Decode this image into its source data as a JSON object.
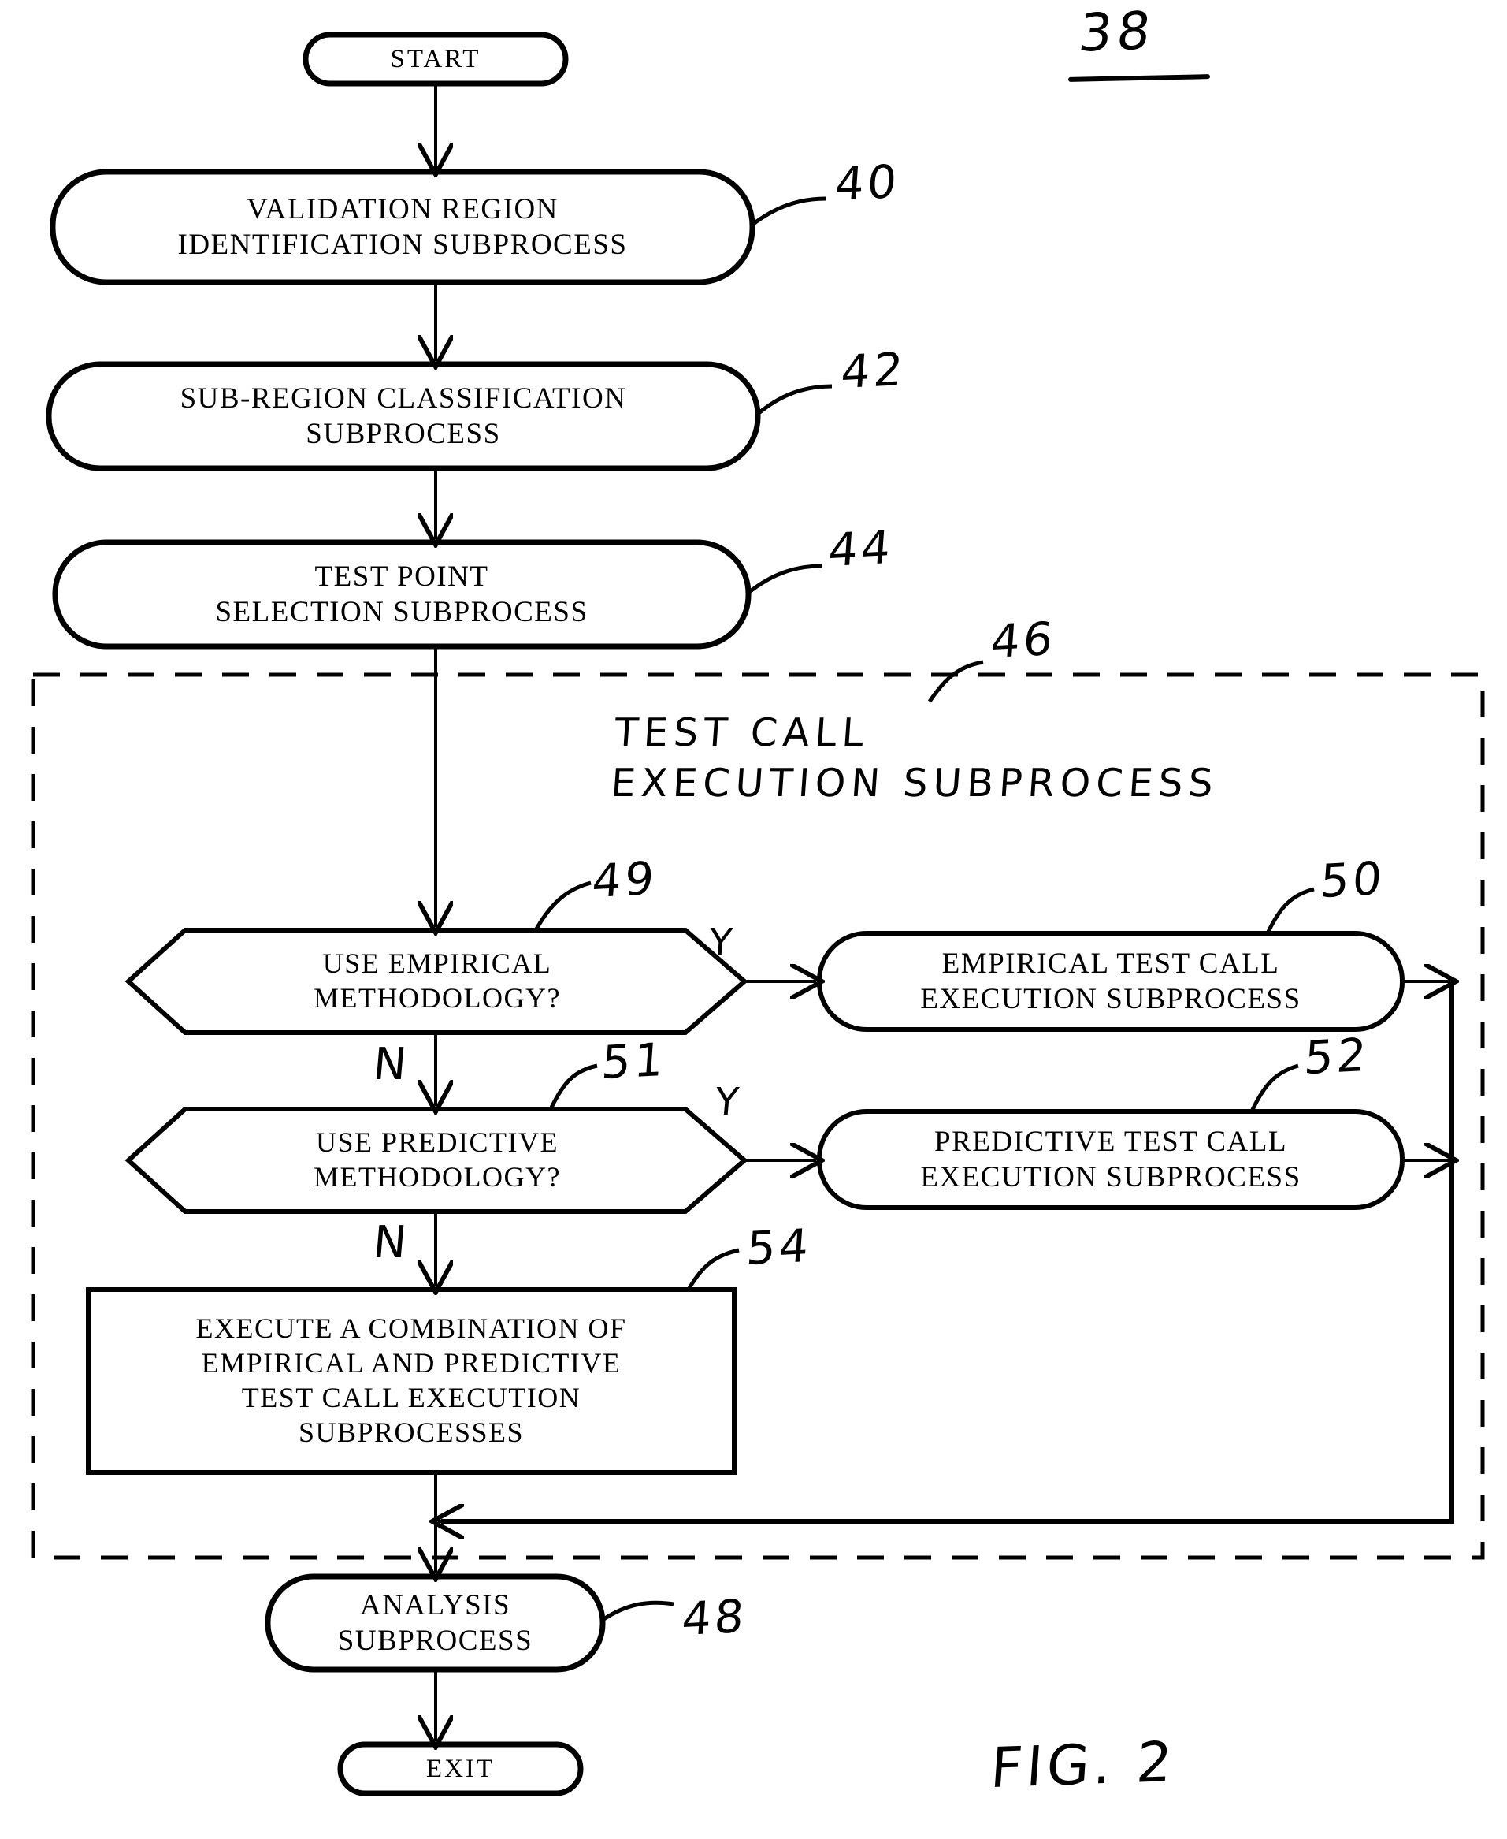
{
  "figure": {
    "figure_label": "FIG. 2",
    "diagram_number": "38",
    "type": "flowchart"
  },
  "nodes": {
    "start": {
      "text": "START",
      "shape": "terminator"
    },
    "validation": {
      "line1": "VALIDATION REGION",
      "line2": "IDENTIFICATION SUBPROCESS",
      "ref": "40",
      "shape": "rounded-process"
    },
    "subregion": {
      "line1": "SUB-REGION CLASSIFICATION",
      "line2": "SUBPROCESS",
      "ref": "42",
      "shape": "rounded-process"
    },
    "testpoint": {
      "line1": "TEST POINT",
      "line2": "SELECTION SUBPROCESS",
      "ref": "44",
      "shape": "rounded-process"
    },
    "testcall_group": {
      "title_line1": "TEST  CALL",
      "title_line2": "EXECUTION  SUBPROCESS",
      "ref": "46",
      "shape": "dashed-container"
    },
    "decision_empirical": {
      "line1": "USE EMPIRICAL",
      "line2": "METHODOLOGY?",
      "ref": "49",
      "shape": "hexagon",
      "yes_label": "Y",
      "no_label": "N"
    },
    "empirical_exec": {
      "line1": "EMPIRICAL TEST CALL",
      "line2": "EXECUTION SUBPROCESS",
      "ref": "50",
      "shape": "rounded-process"
    },
    "decision_predictive": {
      "line1": "USE PREDICTIVE",
      "line2": "METHODOLOGY?",
      "ref": "51",
      "shape": "hexagon",
      "yes_label": "Y",
      "no_label": "N"
    },
    "predictive_exec": {
      "line1": "PREDICTIVE TEST CALL",
      "line2": "EXECUTION SUBPROCESS",
      "ref": "52",
      "shape": "rounded-process"
    },
    "combination": {
      "line1": "EXECUTE A COMBINATION OF",
      "line2": "EMPIRICAL AND PREDICTIVE",
      "line3": "TEST CALL EXECUTION",
      "line4": "SUBPROCESSES",
      "ref": "54",
      "shape": "rectangle"
    },
    "analysis": {
      "line1": "ANALYSIS",
      "line2": "SUBPROCESS",
      "ref": "48",
      "shape": "rounded-process"
    },
    "exit": {
      "text": "EXIT",
      "shape": "terminator"
    }
  },
  "colors": {
    "ink": "#000000",
    "paper": "#ffffff"
  }
}
